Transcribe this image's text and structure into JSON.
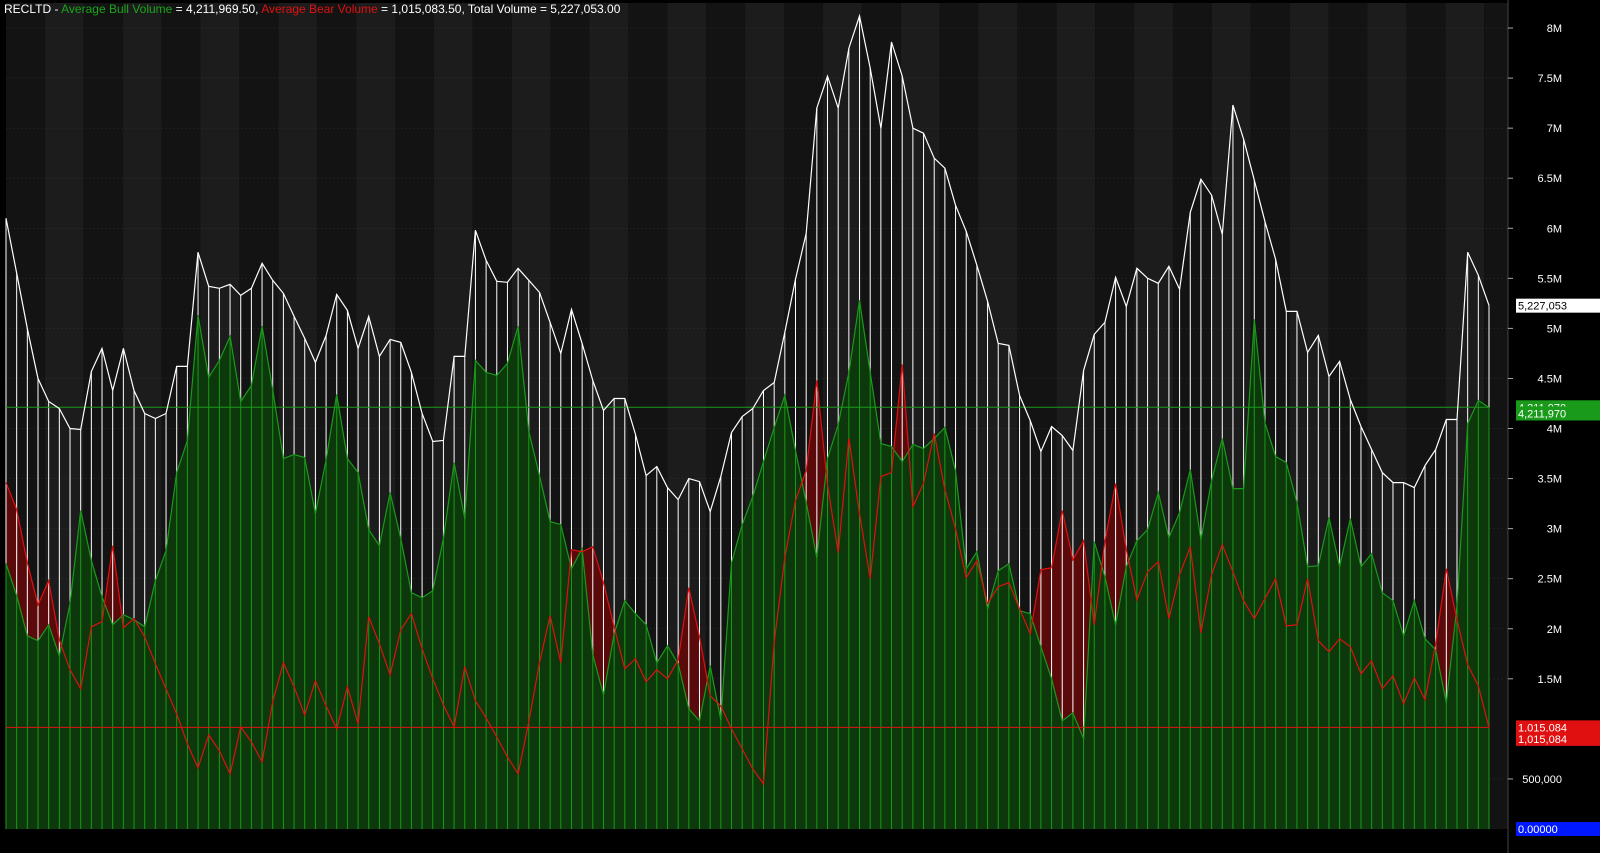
{
  "header": {
    "symbol": "RECLTD",
    "sep": " - ",
    "bull_label": "Average Bull Volume",
    "bull_value": " = 4,211,969.50, ",
    "bear_label": "Average Bear Volume",
    "bear_value": " = 1,015,083.50, ",
    "total_text": "Total Volume = 5,227,053.00"
  },
  "colors": {
    "background": "#000000",
    "band_dark": "#131313",
    "band_light": "#1c1c1c",
    "total": "#ffffff",
    "bull": "#1a9a1a",
    "bull_fill": "#0c3a0c",
    "bear": "#e01010",
    "bear_fill": "#5a0a0a",
    "zero_tag": "#0018ff"
  },
  "chart_data": {
    "type": "line",
    "ylim": [
      0,
      8250000
    ],
    "grid": true,
    "y_ticks": [
      {
        "value": 500000,
        "label": "500,000"
      },
      {
        "value": 1500000,
        "label": "1.5M"
      },
      {
        "value": 2000000,
        "label": "2M"
      },
      {
        "value": 2500000,
        "label": "2.5M"
      },
      {
        "value": 3000000,
        "label": "3M"
      },
      {
        "value": 3500000,
        "label": "3.5M"
      },
      {
        "value": 4000000,
        "label": "4M"
      },
      {
        "value": 4500000,
        "label": "4.5M"
      },
      {
        "value": 5000000,
        "label": "5M"
      },
      {
        "value": 5500000,
        "label": "5.5M"
      },
      {
        "value": 6000000,
        "label": "6M"
      },
      {
        "value": 6500000,
        "label": "6.5M"
      },
      {
        "value": 7000000,
        "label": "7M"
      },
      {
        "value": 7500000,
        "label": "7.5M"
      },
      {
        "value": 8000000,
        "label": "8M"
      }
    ],
    "series": [
      {
        "name": "Total Volume",
        "color": "#ffffff",
        "values": [
          6100000,
          5550000,
          5000000,
          4500000,
          4270000,
          4200000,
          4000000,
          3990000,
          4570000,
          4800000,
          4380000,
          4800000,
          4380000,
          4150000,
          4100000,
          4150000,
          4620000,
          4620000,
          5760000,
          5420000,
          5400000,
          5440000,
          5330000,
          5400000,
          5650000,
          5480000,
          5350000,
          5120000,
          4900000,
          4660000,
          4930000,
          5340000,
          5180000,
          4800000,
          5120000,
          4720000,
          4890000,
          4860000,
          4560000,
          4150000,
          3870000,
          3880000,
          4720000,
          4720000,
          5980000,
          5680000,
          5470000,
          5460000,
          5600000,
          5480000,
          5360000,
          5060000,
          4750000,
          5190000,
          4850000,
          4480000,
          4180000,
          4300000,
          4300000,
          3940000,
          3530000,
          3620000,
          3410000,
          3290000,
          3500000,
          3470000,
          3170000,
          3520000,
          3960000,
          4120000,
          4200000,
          4380000,
          4460000,
          4960000,
          5490000,
          5950000,
          7200000,
          7520000,
          7200000,
          7800000,
          8120000,
          7600000,
          7000000,
          7860000,
          7520000,
          7000000,
          6950000,
          6700000,
          6600000,
          6230000,
          5970000,
          5630000,
          5270000,
          4850000,
          4830000,
          4330000,
          4080000,
          3770000,
          4020000,
          3930000,
          3780000,
          4580000,
          4940000,
          5060000,
          5510000,
          5220000,
          5600000,
          5500000,
          5450000,
          5620000,
          5390000,
          6160000,
          6490000,
          6330000,
          5940000,
          7230000,
          6890000,
          6480000,
          6070000,
          5690000,
          5170000,
          5170000,
          4760000,
          4930000,
          4520000,
          4670000,
          4290000,
          4020000,
          3790000,
          3560000,
          3460000,
          3460000,
          3410000,
          3630000,
          3790000,
          4090000,
          4090000,
          5760000,
          5530000,
          5230000
        ]
      },
      {
        "name": "Average Bull Volume",
        "color": "#1a9a1a",
        "values": [
          2650000,
          2330000,
          1930000,
          1880000,
          2040000,
          1730000,
          2250000,
          3180000,
          2680000,
          2320000,
          2040000,
          2140000,
          2090000,
          2020000,
          2480000,
          2780000,
          3560000,
          3880000,
          5130000,
          4510000,
          4680000,
          4920000,
          4270000,
          4430000,
          5020000,
          4390000,
          3700000,
          3740000,
          3710000,
          3150000,
          3690000,
          4340000,
          3700000,
          3560000,
          2990000,
          2830000,
          3360000,
          2900000,
          2360000,
          2310000,
          2380000,
          2900000,
          3660000,
          3100000,
          4680000,
          4560000,
          4530000,
          4650000,
          5020000,
          3970000,
          3530000,
          3070000,
          3040000,
          2600000,
          2800000,
          1740000,
          1340000,
          1950000,
          2280000,
          2150000,
          2040000,
          1660000,
          1830000,
          1650000,
          1200000,
          1080000,
          1630000,
          1090000,
          2660000,
          3040000,
          3320000,
          3670000,
          4010000,
          4330000,
          3780000,
          3260000,
          2710000,
          3700000,
          4040000,
          4560000,
          5280000,
          4560000,
          3850000,
          3820000,
          3670000,
          3840000,
          3800000,
          3900000,
          4010000,
          3580000,
          2600000,
          2770000,
          2200000,
          2580000,
          2650000,
          2180000,
          2150000,
          1820000,
          1500000,
          1080000,
          1160000,
          900000,
          2870000,
          2520000,
          2040000,
          2620000,
          2880000,
          2990000,
          3360000,
          2910000,
          3160000,
          3590000,
          2890000,
          3480000,
          3900000,
          3400000,
          3400000,
          5090000,
          4060000,
          3720000,
          3660000,
          3260000,
          2620000,
          2630000,
          3110000,
          2620000,
          3100000,
          2620000,
          2750000,
          2360000,
          2280000,
          1930000,
          2280000,
          1900000,
          1790000,
          1260000,
          2230000,
          4050000,
          4280000,
          4210000
        ]
      },
      {
        "name": "Average Bear Volume",
        "color": "#e01010",
        "values": [
          3460000,
          3190000,
          2660000,
          2240000,
          2480000,
          1890000,
          1590000,
          1400000,
          2020000,
          2070000,
          2830000,
          2010000,
          2100000,
          1920000,
          1650000,
          1400000,
          1150000,
          850000,
          610000,
          940000,
          780000,
          550000,
          1020000,
          870000,
          670000,
          1270000,
          1660000,
          1420000,
          1140000,
          1480000,
          1230000,
          1000000,
          1420000,
          1050000,
          2120000,
          1850000,
          1540000,
          1990000,
          2150000,
          1800000,
          1500000,
          1240000,
          1020000,
          1620000,
          1280000,
          1110000,
          920000,
          720000,
          550000,
          1070000,
          1660000,
          2130000,
          1660000,
          2790000,
          2770000,
          2820000,
          2460000,
          2020000,
          1600000,
          1700000,
          1470000,
          1590000,
          1500000,
          1690000,
          2410000,
          1920000,
          1330000,
          1230000,
          1000000,
          800000,
          600000,
          450000,
          1870000,
          2710000,
          3280000,
          3580000,
          4480000,
          3440000,
          2760000,
          3900000,
          3150000,
          2500000,
          3520000,
          3560000,
          4640000,
          3220000,
          3450000,
          3950000,
          3390000,
          3000000,
          2510000,
          2680000,
          2250000,
          2420000,
          2460000,
          2200000,
          1950000,
          2590000,
          2610000,
          3180000,
          2690000,
          2880000,
          2040000,
          2870000,
          3450000,
          2790000,
          2290000,
          2570000,
          2670000,
          2100000,
          2540000,
          2820000,
          1960000,
          2540000,
          2840000,
          2570000,
          2280000,
          2100000,
          2300000,
          2500000,
          2030000,
          2040000,
          2500000,
          1880000,
          1770000,
          1900000,
          1820000,
          1550000,
          1680000,
          1400000,
          1530000,
          1250000,
          1510000,
          1290000,
          1850000,
          2600000,
          2090000,
          1640000,
          1430000,
          1010000
        ]
      }
    ],
    "reference_lines": [
      {
        "name": "Average Bull Volume",
        "value": 4211970,
        "color": "#1a9a1a"
      },
      {
        "name": "Average Bear Volume",
        "value": 1015084,
        "color": "#e01010"
      }
    ],
    "value_tags": [
      {
        "label": "5,227,053",
        "value": 5227053,
        "bg": "#ffffff",
        "fg": "#000000"
      },
      {
        "label": "4,211,970",
        "value": 4211970,
        "bg": "#1a9a1a",
        "fg": "#ffffff"
      },
      {
        "label": "4,211,970",
        "value": 4150000,
        "bg": "#1a9a1a",
        "fg": "#ffffff"
      },
      {
        "label": "1,015,084",
        "value": 1015084,
        "bg": "#e01010",
        "fg": "#ffffff"
      },
      {
        "label": "1,015,084",
        "value": 900000,
        "bg": "#e01010",
        "fg": "#ffffff"
      },
      {
        "label": "0.00000",
        "value": 0,
        "bg": "#0018ff",
        "fg": "#ffffff"
      }
    ]
  }
}
